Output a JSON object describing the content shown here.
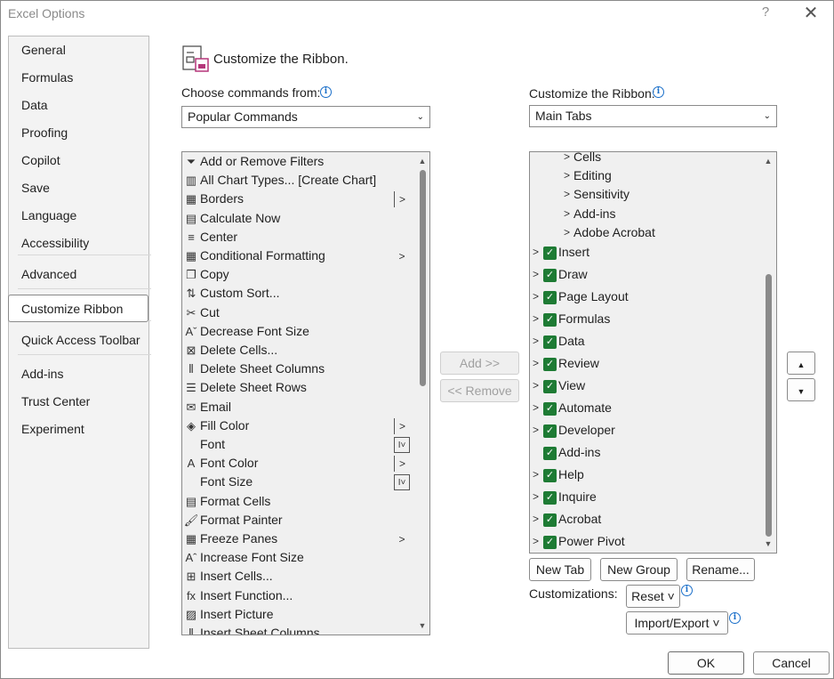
{
  "window": {
    "title": "Excel Options",
    "help": "?",
    "close": "✕"
  },
  "nav": {
    "items": [
      {
        "label": "General"
      },
      {
        "label": "Formulas"
      },
      {
        "label": "Data"
      },
      {
        "label": "Proofing"
      },
      {
        "label": "Copilot"
      },
      {
        "label": "Save"
      },
      {
        "label": "Language"
      },
      {
        "label": "Accessibility"
      },
      {
        "label": "Advanced"
      },
      {
        "label": "Customize Ribbon"
      },
      {
        "label": "Quick Access Toolbar"
      },
      {
        "label": "Add-ins"
      },
      {
        "label": "Trust Center"
      },
      {
        "label": "Experiment"
      }
    ],
    "selected": "Customize Ribbon"
  },
  "header": {
    "title": "Customize the Ribbon."
  },
  "commands": {
    "label": "Choose commands from:",
    "value": "Popular Commands",
    "items": [
      {
        "label": "Add or Remove Filters",
        "icon": "filter-icon",
        "glyph": "⏷",
        "sub": ""
      },
      {
        "label": "All Chart Types... [Create Chart]",
        "icon": "chart-icon",
        "glyph": "▥",
        "sub": ""
      },
      {
        "label": "Borders",
        "icon": "borders-icon",
        "glyph": "▦",
        "sub": "|>"
      },
      {
        "label": "Calculate Now",
        "icon": "calculator-icon",
        "glyph": "▤",
        "sub": ""
      },
      {
        "label": "Center",
        "icon": "align-center-icon",
        "glyph": "≡",
        "sub": ""
      },
      {
        "label": "Conditional Formatting",
        "icon": "conditional-format-icon",
        "glyph": "▦",
        "sub": ">"
      },
      {
        "label": "Copy",
        "icon": "copy-icon",
        "glyph": "❐",
        "sub": ""
      },
      {
        "label": "Custom Sort...",
        "icon": "sort-icon",
        "glyph": "⇅",
        "sub": ""
      },
      {
        "label": "Cut",
        "icon": "scissors-icon",
        "glyph": "✂",
        "sub": ""
      },
      {
        "label": "Decrease Font Size",
        "icon": "decrease-font-icon",
        "glyph": "Aˇ",
        "sub": ""
      },
      {
        "label": "Delete Cells...",
        "icon": "delete-cells-icon",
        "glyph": "⊠",
        "sub": ""
      },
      {
        "label": "Delete Sheet Columns",
        "icon": "delete-columns-icon",
        "glyph": "⫴",
        "sub": ""
      },
      {
        "label": "Delete Sheet Rows",
        "icon": "delete-rows-icon",
        "glyph": "☰",
        "sub": ""
      },
      {
        "label": "Email",
        "icon": "email-icon",
        "glyph": "✉",
        "sub": ""
      },
      {
        "label": "Fill Color",
        "icon": "fill-color-icon",
        "glyph": "◈",
        "sub": "|>"
      },
      {
        "label": "Font",
        "icon": "",
        "glyph": "",
        "sub": "box"
      },
      {
        "label": "Font Color",
        "icon": "font-color-icon",
        "glyph": "A",
        "sub": "|>"
      },
      {
        "label": "Font Size",
        "icon": "",
        "glyph": "",
        "sub": "box"
      },
      {
        "label": "Format Cells",
        "icon": "format-cells-icon",
        "glyph": "▤",
        "sub": ""
      },
      {
        "label": "Format Painter",
        "icon": "format-painter-icon",
        "glyph": "🖌",
        "sub": ""
      },
      {
        "label": "Freeze Panes",
        "icon": "freeze-panes-icon",
        "glyph": "▦",
        "sub": ">"
      },
      {
        "label": "Increase Font Size",
        "icon": "increase-font-icon",
        "glyph": "Aˆ",
        "sub": ""
      },
      {
        "label": "Insert Cells...",
        "icon": "insert-cells-icon",
        "glyph": "⊞",
        "sub": ""
      },
      {
        "label": "Insert Function...",
        "icon": "function-icon",
        "glyph": "fx",
        "sub": ""
      },
      {
        "label": "Insert Picture",
        "icon": "picture-icon",
        "glyph": "▨",
        "sub": ""
      },
      {
        "label": "Insert Sheet Columns",
        "icon": "insert-columns-icon",
        "glyph": "⫴",
        "sub": ""
      }
    ]
  },
  "ribbon": {
    "label": "Customize the Ribbon:",
    "value": "Main Tabs",
    "groups": [
      {
        "label": "Cells"
      },
      {
        "label": "Editing"
      },
      {
        "label": "Sensitivity"
      },
      {
        "label": "Add-ins"
      },
      {
        "label": "Adobe Acrobat"
      }
    ],
    "tabs": [
      {
        "label": "Insert",
        "expandable": true
      },
      {
        "label": "Draw",
        "expandable": true
      },
      {
        "label": "Page Layout",
        "expandable": true
      },
      {
        "label": "Formulas",
        "expandable": true
      },
      {
        "label": "Data",
        "expandable": true
      },
      {
        "label": "Review",
        "expandable": true
      },
      {
        "label": "View",
        "expandable": true
      },
      {
        "label": "Automate",
        "expandable": true
      },
      {
        "label": "Developer",
        "expandable": true
      },
      {
        "label": "Add-ins",
        "expandable": false
      },
      {
        "label": "Help",
        "expandable": true
      },
      {
        "label": "Inquire",
        "expandable": true
      },
      {
        "label": "Acrobat",
        "expandable": true
      },
      {
        "label": "Power Pivot",
        "expandable": true
      }
    ]
  },
  "buttons": {
    "add": "Add >>",
    "remove": "<< Remove",
    "new_tab": "New Tab",
    "new_group": "New Group",
    "rename": "Rename...",
    "customizations_label": "Customizations:",
    "reset": "Reset ˅",
    "import_export": "Import/Export ˅",
    "ok": "OK",
    "cancel": "Cancel"
  }
}
